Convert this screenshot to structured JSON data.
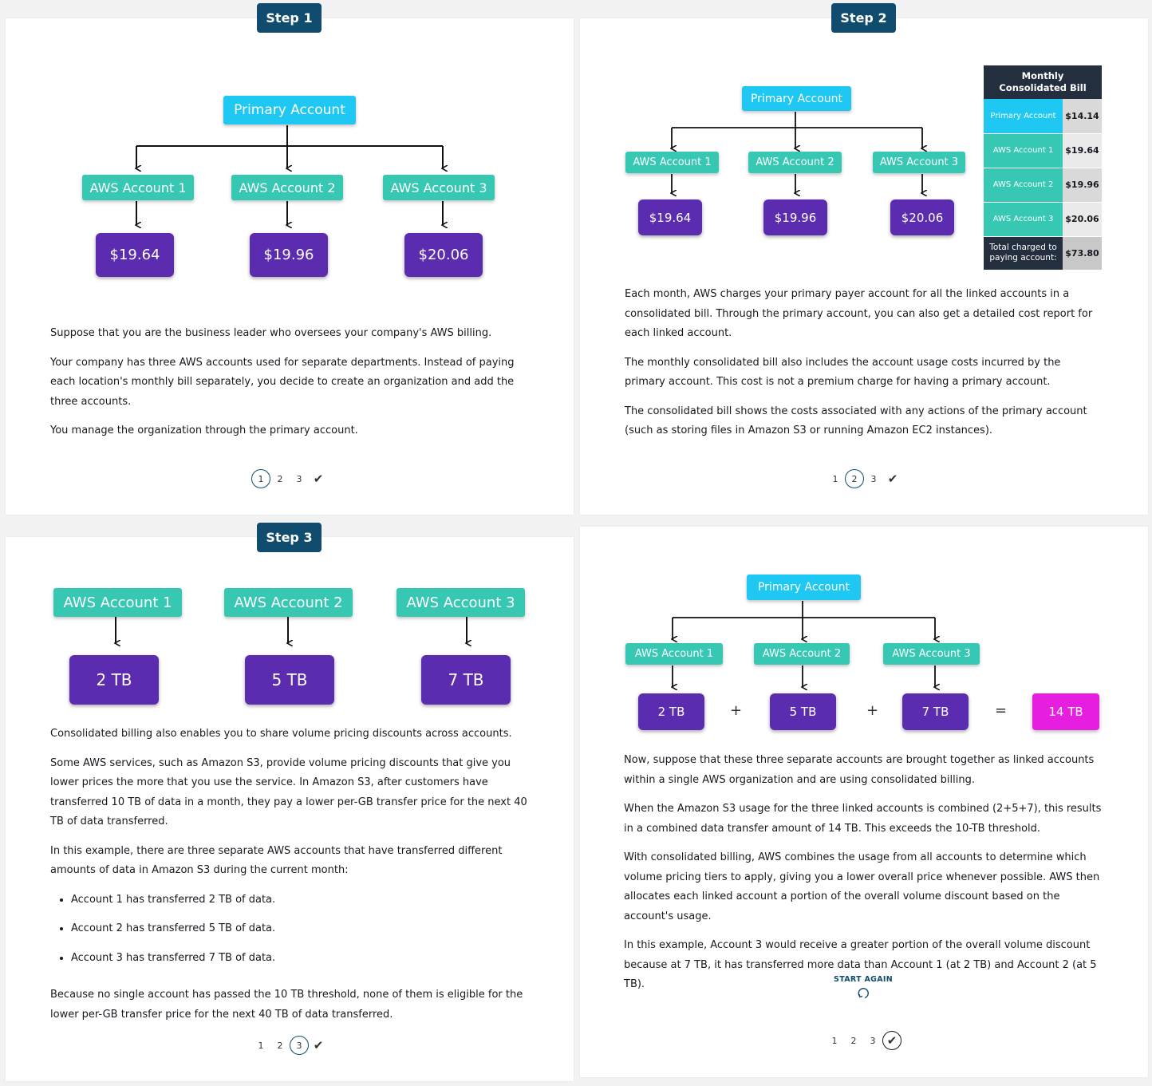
{
  "step1": {
    "badge": "Step 1",
    "primary": "Primary Account",
    "accounts": [
      "AWS Account 1",
      "AWS Account 2",
      "AWS Account 3"
    ],
    "costs": [
      "$19.64",
      "$19.96",
      "$20.06"
    ],
    "paragraphs": [
      "Suppose that you are the business leader who oversees your company's AWS billing.",
      "Your company has three AWS accounts used for separate departments. Instead of paying each location's monthly bill separately, you decide to create an organization and add the three accounts.",
      "You manage the organization through the primary account."
    ],
    "pager": [
      "1",
      "2",
      "3"
    ]
  },
  "step2": {
    "badge": "Step 2",
    "primary": "Primary Account",
    "accounts": [
      "AWS Account 1",
      "AWS Account 2",
      "AWS Account 3"
    ],
    "costs": [
      "$19.64",
      "$19.96",
      "$20.06"
    ],
    "bill": {
      "header": "Monthly Consolidated Bill",
      "rows": [
        {
          "label": "Primary Account",
          "value": "$14.14"
        },
        {
          "label": "AWS Account 1",
          "value": "$19.64"
        },
        {
          "label": "AWS Account 2",
          "value": "$19.96"
        },
        {
          "label": "AWS Account 3",
          "value": "$20.06"
        }
      ],
      "total_label": "Total charged to paying account:",
      "total_value": "$73.80"
    },
    "paragraphs": [
      "Each month, AWS charges your primary payer account for all the linked accounts in a consolidated bill. Through the primary account, you can also get a detailed cost report for each linked account.",
      "The monthly consolidated bill also includes the account usage costs incurred by the primary account. This cost is not a premium charge for having a primary account.",
      "The consolidated bill shows the costs associated with any actions of the primary account (such as storing files in Amazon S3 or running Amazon EC2 instances)."
    ],
    "pager": [
      "1",
      "2",
      "3"
    ]
  },
  "step3": {
    "badge": "Step 3",
    "accounts": [
      "AWS Account 1",
      "AWS Account 2",
      "AWS Account 3"
    ],
    "usage": [
      "2 TB",
      "5 TB",
      "7 TB"
    ],
    "paragraphs": [
      "Consolidated billing also enables you to share volume pricing discounts across accounts.",
      "Some AWS services, such as Amazon S3, provide volume pricing discounts that give you lower prices the more that you use the service. In Amazon S3, after customers have transferred 10 TB of data in a month, they pay a lower per-GB transfer price for the next 40 TB of data transferred.",
      "In this example, there are three separate AWS accounts that have transferred different amounts of data in Amazon S3 during the current month:"
    ],
    "bullets": [
      "Account 1 has transferred 2 TB of data.",
      "Account 2 has transferred 5 TB of data.",
      "Account 3 has transferred 7 TB of data."
    ],
    "closing": "Because no single account has passed the 10 TB threshold, none of them is eligible for the lower per-GB transfer price for the next 40 TB of data transferred.",
    "pager": [
      "1",
      "2",
      "3"
    ]
  },
  "step4": {
    "primary": "Primary Account",
    "accounts": [
      "AWS Account 1",
      "AWS Account 2",
      "AWS Account 3"
    ],
    "usage": [
      "2 TB",
      "5 TB",
      "7 TB"
    ],
    "ops": [
      "+",
      "+",
      "="
    ],
    "total": "14 TB",
    "paragraphs": [
      "Now, suppose that these three separate accounts are brought together as linked accounts within a single AWS organization and are using consolidated billing.",
      "When the Amazon S3 usage for the three linked accounts is combined (2+5+7), this results in a combined data transfer amount of 14 TB. This exceeds the 10-TB threshold.",
      "With consolidated billing, AWS combines the usage from all accounts to determine which volume pricing tiers to apply, giving you a lower overall price whenever possible. AWS then allocates each linked account a portion of the overall volume discount based on the account's usage.",
      "In this example, Account 3 would receive a greater portion of the overall volume discount because at 7 TB, it has transferred more data than Account 1 (at 2 TB) and Account 2 (at 5 TB)."
    ],
    "start_again": "START AGAIN",
    "pager": [
      "1",
      "2",
      "3"
    ]
  }
}
